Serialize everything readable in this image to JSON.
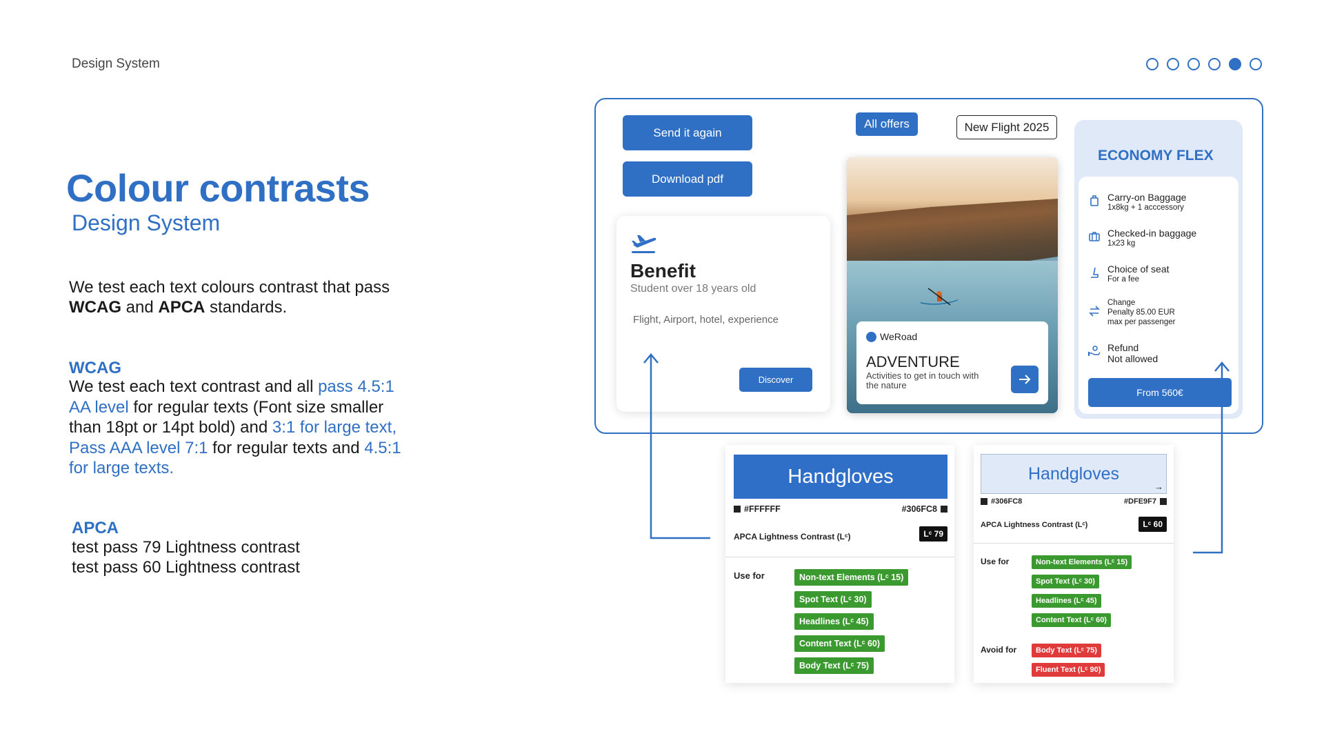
{
  "header": {
    "label": "Design System",
    "pager": {
      "count": 6,
      "active_index": 4
    }
  },
  "left": {
    "title": "Colour contrasts",
    "subtitle": "Design System",
    "intro_prefix": "We test each text colours contrast that pass ",
    "intro_bold1": "WCAG",
    "intro_mid": " and ",
    "intro_bold2": "APCA",
    "intro_suffix": " standards.",
    "wcag_heading": "WCAG",
    "wcag_parts": [
      {
        "text": "We test each text contrast and all ",
        "hl": false
      },
      {
        "text": "pass 4.5:1 AA level",
        "hl": true
      },
      {
        "text": " for regular texts (Font size smaller than 18pt or 14pt bold) and ",
        "hl": false
      },
      {
        "text": "3:1 for large text, Pass AAA level 7:1",
        "hl": true
      },
      {
        "text": " for regular texts and ",
        "hl": false
      },
      {
        "text": "4.5:1 for large texts.",
        "hl": true
      }
    ],
    "apca_heading": "APCA",
    "apca_line1": "test pass 79 Lightness contrast",
    "apca_line2": "test pass 60 Lightness contrast"
  },
  "demo": {
    "send_again": "Send it again",
    "download_pdf": "Download pdf",
    "all_offers": "All offers",
    "new_flight": "New Flight 2025",
    "benefit": {
      "icon": "plane-takeoff-icon",
      "title": "Benefit",
      "subtitle": "Student over 18 years old",
      "tags": "Flight, Airport, hotel, experience",
      "button": "Discover"
    },
    "adventure": {
      "brand": "WeRoad",
      "title": "ADVENTURE",
      "description": "Activities to get in touch with the nature",
      "arrow_icon": "arrow-right-icon"
    },
    "economy": {
      "title": "ECONOMY FLEX",
      "items": [
        {
          "icon": "carry-on-bag-icon",
          "title": "Carry-on Baggage",
          "lines": [
            "1x8kg + 1 acccessory"
          ]
        },
        {
          "icon": "suitcase-icon",
          "title": "Checked-in baggage",
          "lines": [
            "1x23 kg"
          ]
        },
        {
          "icon": "seat-icon",
          "title": "Choice of seat",
          "lines": [
            "For a fee"
          ]
        },
        {
          "icon": "swap-icon",
          "title": "Change",
          "lines": [
            "Penalty 85.00 EUR",
            "max per passenger"
          ]
        },
        {
          "icon": "refund-icon",
          "title": "Refund",
          "lines": [
            "Not allowed"
          ]
        }
      ],
      "button": "From 560€"
    }
  },
  "specimen1": {
    "sample": "Handgloves",
    "fg_hex": "#FFFFFF",
    "bg_hex": "#306FC8",
    "apca_label": "APCA Lightness Contrast (Lᶜ)",
    "lc_value": "Lᶜ 79",
    "use_for": "Use for",
    "use_tags": [
      "Non-text Elements (Lᶜ 15)",
      "Spot Text (Lᶜ 30)",
      "Headlines (Lᶜ 45)",
      "Content Text (Lᶜ 60)",
      "Body Text (Lᶜ 75)"
    ],
    "colors": {
      "bg": "#306fc8",
      "fg": "#ffffff"
    }
  },
  "specimen2": {
    "sample": "Handgloves",
    "fg_hex": "#306FC8",
    "bg_hex": "#DFE9F7",
    "apca_label": "APCA Lightness Contrast (Lᶜ)",
    "lc_value": "Lᶜ 60",
    "use_for": "Use for",
    "use_tags": [
      "Non-text Elements (Lᶜ 15)",
      "Spot Text (Lᶜ 30)",
      "Headlines (Lᶜ 45)",
      "Content Text (Lᶜ 60)"
    ],
    "avoid_for": "Avoid for",
    "avoid_tags": [
      "Body Text (Lᶜ 75)",
      "Fluent Text (Lᶜ 90)"
    ],
    "colors": {
      "bg": "#dfe9f7",
      "fg": "#306fc8"
    }
  },
  "colors": {
    "accent": "#2f6fc4",
    "pass": "#3b9a2f",
    "fail": "#e03a3a"
  }
}
